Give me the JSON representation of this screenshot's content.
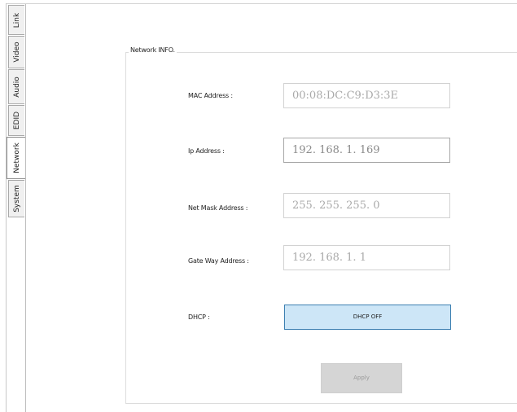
{
  "tabs": [
    {
      "label": "Link",
      "active": false
    },
    {
      "label": "Video",
      "active": false
    },
    {
      "label": "Audio",
      "active": false
    },
    {
      "label": "EDID",
      "active": false
    },
    {
      "label": "Network",
      "active": true
    },
    {
      "label": "System",
      "active": false
    }
  ],
  "group": {
    "title": "Network INFO."
  },
  "fields": {
    "mac": {
      "label": "MAC Address :",
      "value": "00:08:DC:C9:D3:3E",
      "editable": false
    },
    "ip": {
      "label": "Ip Address :",
      "value": "192. 168. 1. 169",
      "editable": true
    },
    "netmask": {
      "label": "Net Mask Address :",
      "value": "255. 255. 255. 0",
      "editable": false
    },
    "gateway": {
      "label": "Gate Way Address :",
      "value": "192. 168. 1. 1",
      "editable": false
    }
  },
  "dhcp": {
    "label": "DHCP :",
    "button_label": "DHCP OFF"
  },
  "apply": {
    "label": "Apply",
    "enabled": false
  },
  "colors": {
    "dhcp_button_bg": "#cde6f7",
    "dhcp_button_border": "#3c7fb1",
    "apply_disabled_bg": "#d5d5d5"
  }
}
